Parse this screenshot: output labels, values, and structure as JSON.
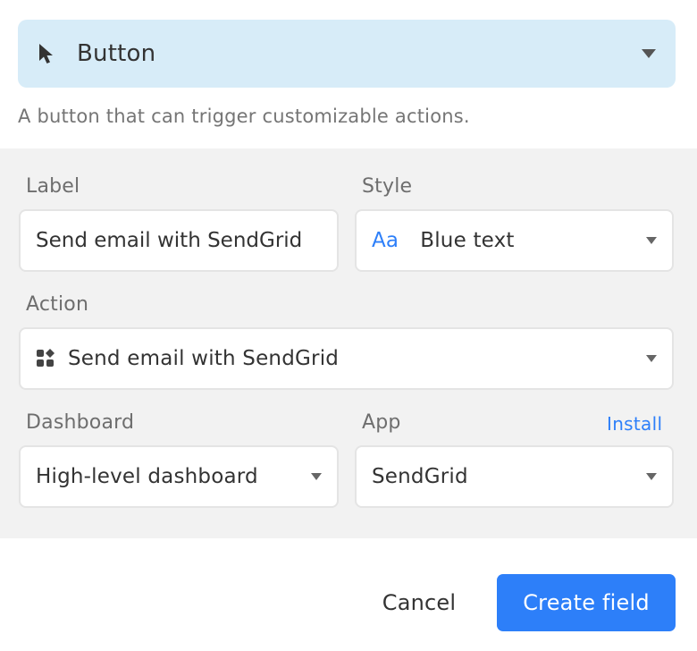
{
  "field_type": {
    "icon": "cursor-arrow-icon",
    "label": "Button",
    "description": "A button that can trigger customizable actions."
  },
  "options": {
    "label": {
      "heading": "Label",
      "value": "Send email with SendGrid"
    },
    "style": {
      "heading": "Style",
      "preview_glyph": "Aa",
      "value": "Blue text",
      "accent_color": "#2d7ff9"
    },
    "action": {
      "heading": "Action",
      "icon": "apps-icon",
      "value": "Send email with SendGrid"
    },
    "dashboard": {
      "heading": "Dashboard",
      "value": "High-level dashboard"
    },
    "app": {
      "heading": "App",
      "install_label": "Install",
      "value": "SendGrid"
    }
  },
  "footer": {
    "cancel_label": "Cancel",
    "create_label": "Create field",
    "primary_color": "#2d7ff9"
  }
}
